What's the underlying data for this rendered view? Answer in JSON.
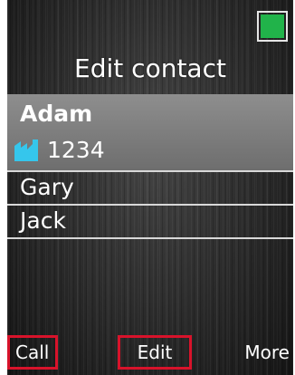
{
  "status": {
    "battery_icon": "battery-full-icon",
    "battery_color": "#21b34a"
  },
  "header": {
    "title": "Edit contact"
  },
  "contacts": [
    {
      "name": "Adam",
      "number": "1234",
      "number_icon": "office-phone-icon",
      "selected": true
    },
    {
      "name": "Gary"
    },
    {
      "name": "Jack"
    }
  ],
  "softkeys": {
    "left": "Call",
    "center": "Edit",
    "right": "More"
  },
  "colors": {
    "highlight_box": "#d8132b",
    "selection_bg": "#7e7e7e",
    "icon_accent": "#35c6ec"
  }
}
